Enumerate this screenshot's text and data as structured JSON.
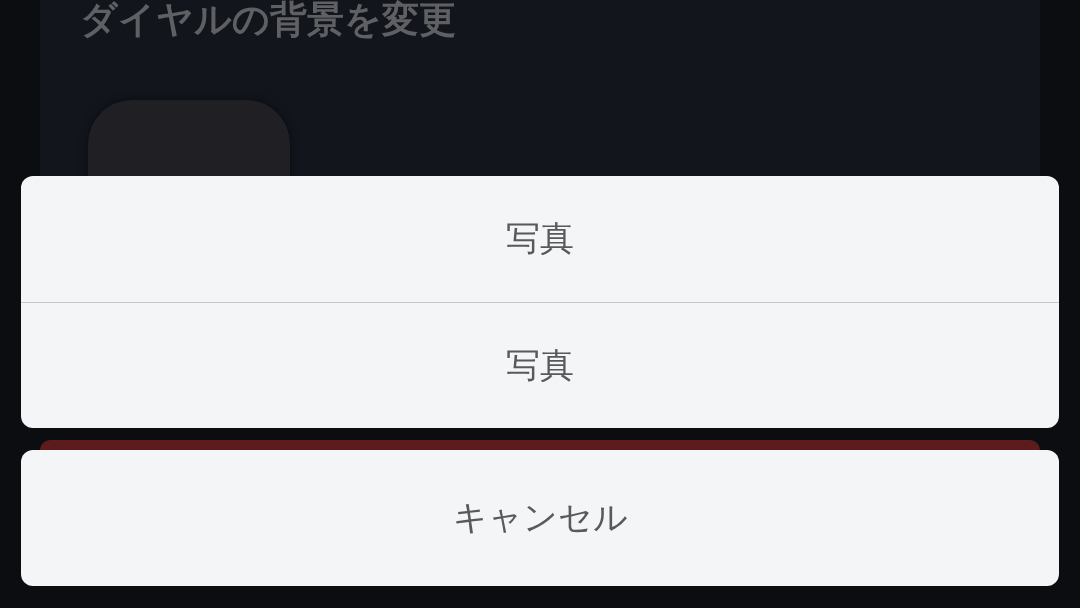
{
  "screen": {
    "title": "ダイヤルの背景を変更"
  },
  "action_sheet": {
    "options": [
      {
        "label": "写真"
      },
      {
        "label": "写真"
      }
    ],
    "cancel": "キャンセル"
  }
}
